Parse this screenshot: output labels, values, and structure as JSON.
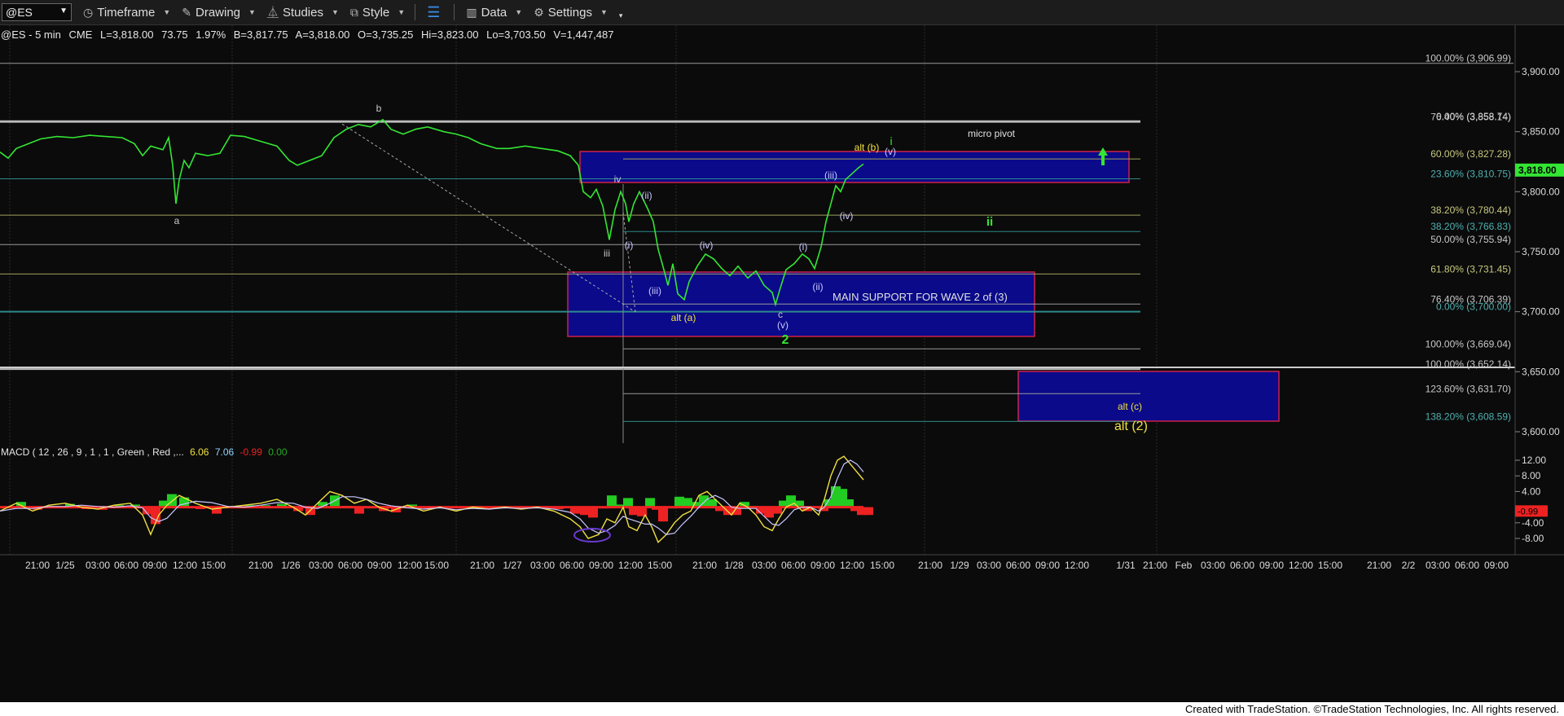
{
  "toolbar": {
    "symbol": "@ES",
    "timeframe": "Timeframe",
    "drawing": "Drawing",
    "studies": "Studies",
    "style": "Style",
    "data": "Data",
    "settings": "Settings"
  },
  "header": {
    "symbol": "@ES - 5 min",
    "exchange": "CME",
    "last": "L=3,818.00",
    "change": "73.75",
    "change_pct": "1.97%",
    "bid": "B=3,817.75",
    "ask": "A=3,818.00",
    "open": "O=3,735.25",
    "high": "Hi=3,823.00",
    "low": "Lo=3,703.50",
    "volume": "V=1,447,487"
  },
  "colors": {
    "price": "#33e633",
    "macd": "#f0e040",
    "signal": "#c8c8ff",
    "hist_pos": "#22cc22",
    "hist_neg": "#ee2222",
    "box": "#0a0a8a",
    "box_border": "#d0204a",
    "fib_text": "#c8c8c8"
  },
  "price_axis": {
    "ticks": [
      "3,900.00",
      "3,850.00",
      "3,800.00",
      "3,750.00",
      "3,700.00",
      "3,650.00",
      "3,600.00"
    ],
    "tick_values": [
      3900,
      3850,
      3800,
      3750,
      3700,
      3650,
      3600
    ],
    "current": "3,818.00",
    "current_value": 3818
  },
  "macd_axis": {
    "ticks": [
      "12.00",
      "8.00",
      "4.00",
      "-4.00",
      "-8.00"
    ],
    "tick_values": [
      12,
      8,
      4,
      -4,
      -8
    ],
    "current": "-0.99",
    "current_value": -0.99
  },
  "time_axis": {
    "labels": [
      "21:00",
      "1/25",
      "03:00",
      "06:00",
      "09:00",
      "12:00",
      "15:00",
      "21:00",
      "1/26",
      "03:00",
      "06:00",
      "09:00",
      "12:00",
      "15:00",
      "21:00",
      "1/27",
      "03:00",
      "06:00",
      "09:00",
      "12:00",
      "15:00",
      "21:00",
      "1/28",
      "03:00",
      "06:00",
      "09:00",
      "12:00",
      "15:00",
      "21:00",
      "1/29",
      "03:00",
      "06:00",
      "09:00",
      "12:00",
      "1/31",
      "21:00",
      "Feb",
      "03:00",
      "06:00",
      "09:00",
      "12:00",
      "15:00",
      "21:00",
      "2/2",
      "03:00",
      "06:00",
      "09:00"
    ]
  },
  "fib_levels": [
    {
      "label": "100.00% (3,906.99)",
      "value": 3906.99
    },
    {
      "label": "0.00% (3,858.74)",
      "value": 3858.74
    },
    {
      "label": "76.40% (3,858.14)",
      "value": 3858.14
    },
    {
      "label": "60.00% (3,827.28)",
      "value": 3827.28
    },
    {
      "label": "23.60% (3,810.75)",
      "value": 3810.75
    },
    {
      "label": "38.20% (3,780.44)",
      "value": 3780.44
    },
    {
      "label": "38.20% (3,766.83)",
      "value": 3766.83
    },
    {
      "label": "50.00% (3,755.94)",
      "value": 3755.94
    },
    {
      "label": "61.80% (3,731.45)",
      "value": 3731.45
    },
    {
      "label": "76.40% (3,706.39)",
      "value": 3706.39
    },
    {
      "label": "0.00% (3,700.00)",
      "value": 3700.0
    },
    {
      "label": "100.00% (3,669.04)",
      "value": 3669.04
    },
    {
      "label": "100.00% (3,652.14)",
      "value": 3652.14
    },
    {
      "label": "123.60% (3,631.70)",
      "value": 3631.7
    },
    {
      "label": "138.20% (3,608.59)",
      "value": 3608.59
    }
  ],
  "zones": {
    "micro_pivot": "micro pivot",
    "main_support": "MAIN SUPPORT FOR WAVE 2 of (3)",
    "alt_c": "alt (c)",
    "alt_2": "alt (2)"
  },
  "wave_labels": {
    "a": "a",
    "b": "b",
    "iii_small": "iii",
    "iv_small": "iv",
    "i_paren": "(i)",
    "ii_paren": "(ii)",
    "iii_paren": "(iii)",
    "iv_paren": "(iv)",
    "alt_a": "alt (a)",
    "c": "c",
    "v_paren": "(v)",
    "two": "2",
    "i2_paren": "(i)",
    "ii2_paren": "(ii)",
    "iii2_paren": "(iii)",
    "iv2_paren": "(iv)",
    "alt_b": "alt (b)",
    "i_green": "i",
    "v2_paren": "(v)",
    "ii_green": "ii"
  },
  "macd": {
    "label": "MACD ( 12 , 26 , 9 , 1 , 1 , Green , Red ,...",
    "v1": "6.06",
    "v2": "7.06",
    "v3": "-0.99",
    "v4": "0.00"
  },
  "footer": "Created with TradeStation. ©TradeStation Technologies, Inc. All rights reserved."
}
